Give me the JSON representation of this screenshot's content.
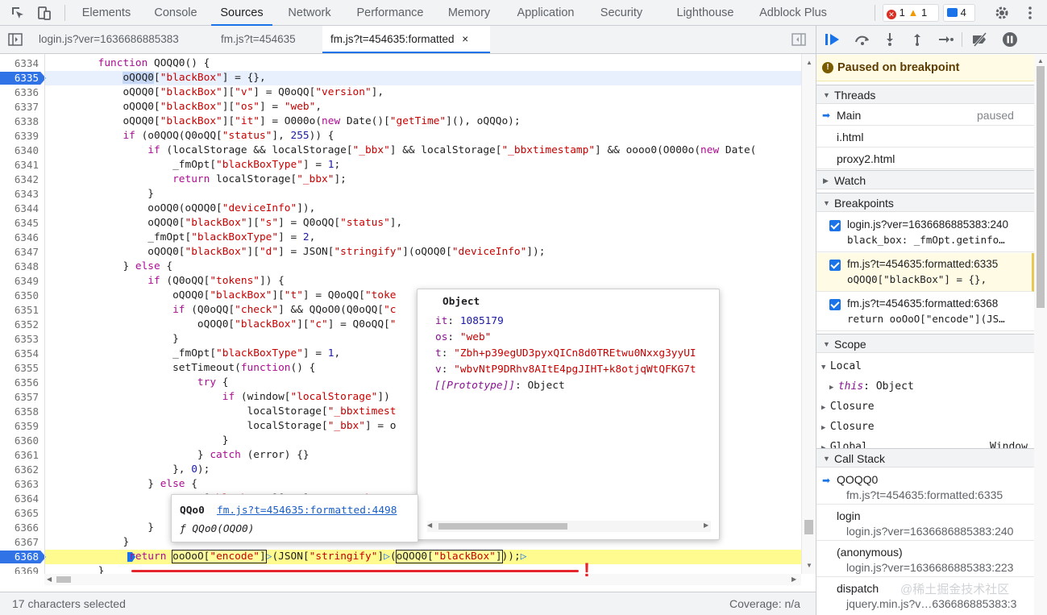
{
  "toolbar": {
    "tabs": [
      "Elements",
      "Console",
      "Sources",
      "Network",
      "Performance",
      "Memory",
      "Application",
      "Security",
      "Lighthouse",
      "Adblock Plus"
    ],
    "active_tab": "Sources",
    "errors": "1",
    "warnings": "1",
    "messages": "4"
  },
  "file_tabs": [
    "login.js?ver=1636686885383",
    "fm.js?t=454635",
    "fm.js?t=454635:formatted"
  ],
  "file_tab_close": "×",
  "code": {
    "lines": [
      {
        "n": "6334",
        "html": "        <span class='k'>function</span> QOQQ0() {"
      },
      {
        "n": "6335",
        "html": "            <span style='background:#c6d7f5'>oQOQ0</span>[<span class='s'>\"blackBox\"</span>] = {},",
        "bp": true
      },
      {
        "n": "6336",
        "html": "            oQOQ0[<span class='s'>\"blackBox\"</span>][<span class='s'>\"v\"</span>] = Q0oQQ[<span class='s'>\"version\"</span>],"
      },
      {
        "n": "6337",
        "html": "            oQOQ0[<span class='s'>\"blackBox\"</span>][<span class='s'>\"os\"</span>] = <span class='s'>\"web\"</span>,"
      },
      {
        "n": "6338",
        "html": "            oQOQ0[<span class='s'>\"blackBox\"</span>][<span class='s'>\"it\"</span>] = O000o(<span class='k'>new</span> Date()[<span class='s'>\"getTime\"</span>](), oQQQo);"
      },
      {
        "n": "6339",
        "html": "            <span class='k'>if</span> (o0QOQ(Q0oQQ[<span class='s'>\"status\"</span>], <span class='n'>255</span>)) {"
      },
      {
        "n": "6340",
        "html": "                <span class='k'>if</span> (localStorage &amp;&amp; localStorage[<span class='s'>\"_bbx\"</span>] &amp;&amp; localStorage[<span class='s'>\"_bbxtimestamp\"</span>] &amp;&amp; oooo0(O000o(<span class='k'>new</span> Date("
      },
      {
        "n": "6341",
        "html": "                    _fmOpt[<span class='s'>\"blackBoxType\"</span>] = <span class='n'>1</span>;"
      },
      {
        "n": "6342",
        "html": "                    <span class='k'>return</span> localStorage[<span class='s'>\"_bbx\"</span>];"
      },
      {
        "n": "6343",
        "html": "                }"
      },
      {
        "n": "6344",
        "html": "                ooOQ0(oQOQ0[<span class='s'>\"deviceInfo\"</span>]),"
      },
      {
        "n": "6345",
        "html": "                oQOQ0[<span class='s'>\"blackBox\"</span>][<span class='s'>\"s\"</span>] = Q0oQQ[<span class='s'>\"status\"</span>],"
      },
      {
        "n": "6346",
        "html": "                _fmOpt[<span class='s'>\"blackBoxType\"</span>] = <span class='n'>2</span>,"
      },
      {
        "n": "6347",
        "html": "                oQOQ0[<span class='s'>\"blackBox\"</span>][<span class='s'>\"d\"</span>] = JSON[<span class='s'>\"stringify\"</span>](oQOQ0[<span class='s'>\"deviceInfo\"</span>]);"
      },
      {
        "n": "6348",
        "html": "            } <span class='k'>else</span> {"
      },
      {
        "n": "6349",
        "html": "                <span class='k'>if</span> (Q0oQQ[<span class='s'>\"tokens\"</span>]) {"
      },
      {
        "n": "6350",
        "html": "                    oQOQ0[<span class='s'>\"blackBox\"</span>][<span class='s'>\"t\"</span>] = Q0oQQ[<span class='s'>\"toke</span>"
      },
      {
        "n": "6351",
        "html": "                    <span class='k'>if</span> (Q0oQQ[<span class='s'>\"check\"</span>] &amp;&amp; QQoO0(Q0oQQ[<span class='s'>\"c</span>"
      },
      {
        "n": "6352",
        "html": "                        oQOQ0[<span class='s'>\"blackBox\"</span>][<span class='s'>\"c\"</span>] = Q0oQQ[<span class='s'>\"</span>"
      },
      {
        "n": "6353",
        "html": "                    }"
      },
      {
        "n": "6354",
        "html": "                    _fmOpt[<span class='s'>\"blackBoxType\"</span>] = <span class='n'>1</span>,"
      },
      {
        "n": "6355",
        "html": "                    setTimeout(<span class='k'>function</span>() {"
      },
      {
        "n": "6356",
        "html": "                        <span class='k'>try</span> {"
      },
      {
        "n": "6357",
        "html": "                            <span class='k'>if</span> (window[<span class='s'>\"localStorage\"</span>])"
      },
      {
        "n": "6358",
        "html": "                                localStorage[<span class='s'>\"_bbxtimest</span>"
      },
      {
        "n": "6359",
        "html": "                                localStorage[<span class='s'>\"_bbx\"</span>] = o                                    <span class='s'>Box\"</span>]));"
      },
      {
        "n": "6360",
        "html": "                            }"
      },
      {
        "n": "6361",
        "html": "                        } <span class='k'>catch</span> (error) {}"
      },
      {
        "n": "6362",
        "html": "                    }, <span class='n'>0</span>);"
      },
      {
        "n": "6363",
        "html": "                } <span class='k'>else</span> {"
      },
      {
        "n": "6364",
        "html": "                    oQOQ0[<span class='s'>\"blackBox\"</span>][<span class='s'>\"e\"</span>] = <span class='s'>\"no token re</span>"
      },
      {
        "n": "6365",
        "html": ""
      },
      {
        "n": "6366",
        "html": "                }"
      },
      {
        "n": "6367",
        "html": "            }"
      },
      {
        "n": "6368",
        "html": "             <span class='k'>return</span> <span style='outline:1px solid #222;background:#ffff9e'>ooOoO[<span class='s'>\"encode\"</span>]</span><span style='color:#1a73e8'>▷</span>(JSON[<span class='s'>\"stringify\"</span>]<span style='color:#1a73e8'>▷</span>(<span style='outline:1px solid #222;background:#ffff9e'>oQOQ0[<span class='s'>\"blackBox\"</span>]</span>));<span style='color:#1a73e8'>▷</span>",
        "bp": true,
        "hl": true
      },
      {
        "n": "6369",
        "html": "        }"
      },
      {
        "n": "6370",
        "html": ""
      }
    ]
  },
  "object_popup": {
    "title": "Object",
    "props": [
      {
        "key": "it",
        "value": "1085179",
        "type": "num"
      },
      {
        "key": "os",
        "value": "\"web\"",
        "type": "str"
      },
      {
        "key": "t",
        "value": "\"Zbh+p39egUD3pyxQICn8d0TREtwu0Nxxg3yyUI",
        "type": "str"
      },
      {
        "key": "v",
        "value": "\"wbvNtP9DRhv8AItE4pgJIHT+k8otjqWtQFKG7t",
        "type": "str"
      }
    ],
    "proto_key": "[[Prototype]]",
    "proto_val": "Object"
  },
  "fn_popup": {
    "name": "QQo0",
    "link": "fm.js?t=454635:formatted:4498",
    "sig": "ƒ QQo0(OQO0)"
  },
  "sidebar": {
    "paused": "Paused on breakpoint",
    "threads_title": "Threads",
    "threads": [
      {
        "name": "Main",
        "state": "paused"
      },
      {
        "name": "i.html",
        "state": ""
      },
      {
        "name": "proxy2.html",
        "state": ""
      }
    ],
    "watch_title": "Watch",
    "breakpoints_title": "Breakpoints",
    "breakpoints": [
      {
        "loc": "login.js?ver=1636686885383:240",
        "code": "black_box: _fmOpt.getinfo…"
      },
      {
        "loc": "fm.js?t=454635:formatted:6335",
        "code": "oQOQ0[\"blackBox\"] = {},"
      },
      {
        "loc": "fm.js?t=454635:formatted:6368",
        "code": "return ooOoO[\"encode\"](JS…"
      }
    ],
    "scope_title": "Scope",
    "scope": {
      "local": "Local",
      "this_key": "this",
      "this_val": "Object",
      "closure1": "Closure",
      "closure2": "Closure",
      "global": "Global",
      "global_val": "Window"
    },
    "callstack_title": "Call Stack",
    "callstack": [
      {
        "fn": "QOQQ0",
        "loc": "fm.js?t=454635:formatted:6335"
      },
      {
        "fn": "login",
        "loc": "login.js?ver=1636686885383:240"
      },
      {
        "fn": "(anonymous)",
        "loc": "login.js?ver=1636686885383:223"
      },
      {
        "fn": "dispatch",
        "loc": "jquery.min.js?v…636686885383:3"
      }
    ]
  },
  "status": {
    "selected": "17 characters selected",
    "coverage": "Coverage: n/a"
  },
  "watermark": "@稀土掘金技术社区",
  "annotation_mark": "!"
}
